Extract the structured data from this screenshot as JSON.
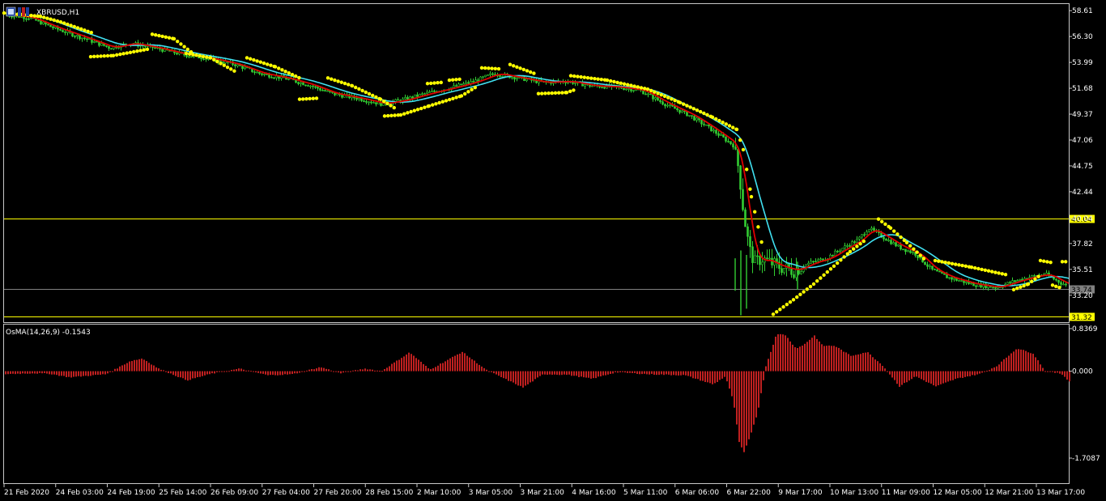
{
  "window": {
    "symbol_title": "XBRUSD,H1",
    "icon": "chart-window-icon"
  },
  "indicator": {
    "title": "OsMA(14,26,9) -0.1543"
  },
  "price_axis": {
    "ticks": [
      "58.61",
      "56.30",
      "53.99",
      "51.68",
      "49.37",
      "47.06",
      "44.75",
      "42.44",
      "40.04",
      "37.82",
      "35.51",
      "33.20"
    ],
    "range": [
      30.8,
      59.2
    ]
  },
  "horizontal_lines": [
    {
      "label": "40.04",
      "value": 40.04,
      "color": "#ffff00"
    },
    {
      "label": "33.74",
      "value": 33.74,
      "color": "#808080"
    },
    {
      "label": "31.32",
      "value": 31.32,
      "color": "#ffff00"
    }
  ],
  "indicator_axis": {
    "ticks": [
      "0.8369",
      "0.000",
      "-1.7087"
    ],
    "range": [
      -1.7087,
      0.8369
    ]
  },
  "time_axis": {
    "ticks": [
      "21 Feb 2020",
      "24 Feb 03:00",
      "24 Feb 19:00",
      "25 Feb 14:00",
      "26 Feb 09:00",
      "27 Feb 04:00",
      "27 Feb 20:00",
      "28 Feb 15:00",
      "2 Mar 10:00",
      "3 Mar 05:00",
      "3 Mar 21:00",
      "4 Mar 16:00",
      "5 Mar 11:00",
      "6 Mar 06:00",
      "6 Mar 22:00",
      "9 Mar 17:00",
      "10 Mar 13:00",
      "11 Mar 09:00",
      "12 Mar 05:00",
      "12 Mar 21:00",
      "13 Mar 17:00"
    ]
  },
  "colors": {
    "background": "#000000",
    "candles": "#32cd32",
    "ma_fast": "#e00000",
    "ma_slow": "#40e0f0",
    "sar": "#ffff00",
    "osma": "#c02020",
    "grid_frame": "#c8c8c8"
  },
  "chart_data": {
    "type": "line",
    "xlabel": "",
    "ylabel": "",
    "price_anchors": [
      [
        0,
        58.3
      ],
      [
        35,
        58.0
      ],
      [
        65,
        57.1
      ],
      [
        105,
        56.1
      ],
      [
        135,
        55.3
      ],
      [
        160,
        55.7
      ],
      [
        190,
        55.3
      ],
      [
        225,
        54.7
      ],
      [
        260,
        54.3
      ],
      [
        290,
        53.8
      ],
      [
        320,
        53.0
      ],
      [
        350,
        52.6
      ],
      [
        380,
        52.0
      ],
      [
        410,
        51.2
      ],
      [
        440,
        50.8
      ],
      [
        470,
        50.3
      ],
      [
        495,
        50.6
      ],
      [
        530,
        51.3
      ],
      [
        560,
        51.8
      ],
      [
        585,
        52.3
      ],
      [
        610,
        53.0
      ],
      [
        640,
        52.6
      ],
      [
        670,
        52.2
      ],
      [
        700,
        52.3
      ],
      [
        730,
        51.9
      ],
      [
        760,
        51.8
      ],
      [
        790,
        51.5
      ],
      [
        820,
        50.3
      ],
      [
        850,
        49.3
      ],
      [
        870,
        48.4
      ],
      [
        890,
        47.4
      ],
      [
        905,
        46.6
      ],
      [
        912,
        44.5
      ],
      [
        918,
        40.5
      ],
      [
        925,
        37.3
      ],
      [
        932,
        36.1
      ],
      [
        940,
        36.5
      ],
      [
        960,
        35.8
      ],
      [
        980,
        35.4
      ],
      [
        1000,
        36.1
      ],
      [
        1020,
        36.5
      ],
      [
        1040,
        37.4
      ],
      [
        1060,
        38.2
      ],
      [
        1072,
        39.2
      ],
      [
        1090,
        38.4
      ],
      [
        1110,
        37.5
      ],
      [
        1130,
        36.9
      ],
      [
        1150,
        35.5
      ],
      [
        1170,
        34.8
      ],
      [
        1200,
        34.2
      ],
      [
        1230,
        33.9
      ],
      [
        1250,
        34.4
      ],
      [
        1270,
        34.8
      ],
      [
        1290,
        35.1
      ],
      [
        1310,
        34.3
      ],
      [
        1320,
        34.0
      ]
    ],
    "osma_anchors": [
      [
        0,
        -0.06
      ],
      [
        40,
        -0.04
      ],
      [
        60,
        -0.05
      ],
      [
        85,
        -0.12
      ],
      [
        130,
        -0.06
      ],
      [
        160,
        0.2
      ],
      [
        175,
        0.25
      ],
      [
        195,
        0.05
      ],
      [
        230,
        -0.18
      ],
      [
        260,
        -0.05
      ],
      [
        295,
        0.05
      ],
      [
        330,
        -0.08
      ],
      [
        360,
        -0.06
      ],
      [
        395,
        0.08
      ],
      [
        420,
        -0.04
      ],
      [
        450,
        0.05
      ],
      [
        470,
        0.0
      ],
      [
        505,
        0.37
      ],
      [
        530,
        0.03
      ],
      [
        570,
        0.38
      ],
      [
        600,
        0.02
      ],
      [
        645,
        -0.32
      ],
      [
        670,
        -0.06
      ],
      [
        700,
        -0.07
      ],
      [
        730,
        -0.15
      ],
      [
        760,
        -0.02
      ],
      [
        800,
        -0.06
      ],
      [
        845,
        -0.08
      ],
      [
        880,
        -0.26
      ],
      [
        895,
        -0.1
      ],
      [
        905,
        -0.6
      ],
      [
        912,
        -1.4
      ],
      [
        918,
        -1.6
      ],
      [
        925,
        -1.3
      ],
      [
        935,
        -0.8
      ],
      [
        945,
        0.1
      ],
      [
        958,
        0.72
      ],
      [
        968,
        0.73
      ],
      [
        982,
        0.45
      ],
      [
        990,
        0.5
      ],
      [
        1005,
        0.7
      ],
      [
        1015,
        0.5
      ],
      [
        1030,
        0.5
      ],
      [
        1050,
        0.3
      ],
      [
        1070,
        0.38
      ],
      [
        1090,
        0.1
      ],
      [
        1110,
        -0.3
      ],
      [
        1130,
        -0.1
      ],
      [
        1155,
        -0.3
      ],
      [
        1180,
        -0.15
      ],
      [
        1210,
        -0.05
      ],
      [
        1230,
        0.1
      ],
      [
        1255,
        0.45
      ],
      [
        1275,
        0.35
      ],
      [
        1290,
        0.0
      ],
      [
        1310,
        -0.05
      ],
      [
        1320,
        -0.2
      ]
    ],
    "sar_segments": [
      [
        [
          5,
          58.4
        ],
        [
          50,
          58.1
        ],
        [
          75,
          57.6
        ],
        [
          115,
          56.6
        ]
      ],
      [
        [
          112,
          54.5
        ],
        [
          140,
          54.6
        ],
        [
          185,
          55.2
        ]
      ],
      [
        [
          188,
          56.5
        ],
        [
          215,
          56.1
        ],
        [
          240,
          54.7
        ]
      ],
      [
        [
          230,
          54.8
        ],
        [
          260,
          54.4
        ],
        [
          290,
          53.2
        ]
      ],
      [
        [
          305,
          54.4
        ],
        [
          340,
          53.6
        ],
        [
          370,
          52.6
        ]
      ],
      [
        [
          370,
          50.7
        ],
        [
          395,
          50.8
        ]
      ],
      [
        [
          405,
          52.6
        ],
        [
          435,
          51.9
        ],
        [
          470,
          50.7
        ],
        [
          490,
          49.8
        ]
      ],
      [
        [
          475,
          49.2
        ],
        [
          495,
          49.3
        ],
        [
          530,
          50.1
        ],
        [
          570,
          51.0
        ],
        [
          588,
          51.8
        ]
      ],
      [
        [
          528,
          52.1
        ],
        [
          545,
          52.2
        ]
      ],
      [
        [
          555,
          52.4
        ],
        [
          570,
          52.5
        ]
      ],
      [
        [
          595,
          53.5
        ],
        [
          620,
          53.4
        ]
      ],
      [
        [
          630,
          53.8
        ],
        [
          660,
          53.0
        ]
      ],
      [
        [
          665,
          51.2
        ],
        [
          700,
          51.3
        ],
        [
          712,
          51.6
        ]
      ],
      [
        [
          705,
          52.8
        ],
        [
          750,
          52.4
        ],
        [
          800,
          51.6
        ],
        [
          840,
          50.4
        ],
        [
          880,
          49.1
        ],
        [
          910,
          48.0
        ],
        [
          918,
          46.2
        ],
        [
          928,
          42.0
        ],
        [
          942,
          37.5
        ]
      ],
      [
        [
          955,
          31.5
        ],
        [
          980,
          32.8
        ],
        [
          1005,
          34.2
        ],
        [
          1030,
          35.8
        ],
        [
          1050,
          37.1
        ],
        [
          1070,
          38.2
        ]
      ],
      [
        [
          1085,
          40.0
        ],
        [
          1100,
          39.2
        ],
        [
          1120,
          37.9
        ],
        [
          1145,
          36.2
        ]
      ],
      [
        [
          1155,
          36.3
        ],
        [
          1200,
          35.7
        ],
        [
          1245,
          35.0
        ]
      ],
      [
        [
          1252,
          33.7
        ],
        [
          1270,
          34.2
        ],
        [
          1285,
          35.0
        ]
      ],
      [
        [
          1285,
          36.3
        ],
        [
          1300,
          36.1
        ]
      ],
      [
        [
          1300,
          34.1
        ],
        [
          1312,
          33.8
        ]
      ],
      [
        [
          1312,
          36.2
        ],
        [
          1320,
          36.2
        ]
      ]
    ]
  }
}
